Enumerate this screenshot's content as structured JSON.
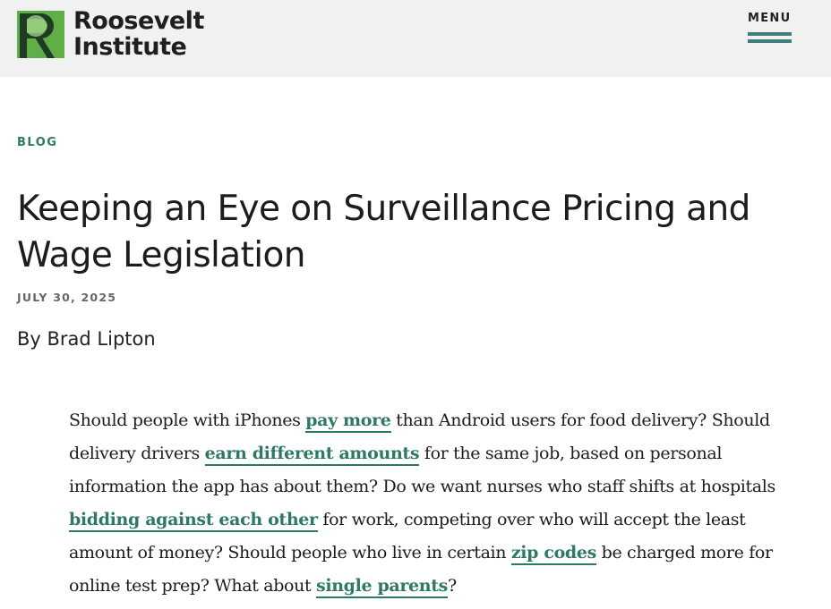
{
  "header": {
    "logo": {
      "line1": "Roosevelt",
      "line2": "Institute",
      "icon": "roosevelt-r-logo"
    },
    "menu_label": "MENU",
    "menu_icon": "hamburger-icon"
  },
  "article": {
    "category": "BLOG",
    "title": "Keeping an Eye on Surveillance Pricing and Wage Legislation",
    "date": "JULY 30, 2025",
    "byline_prefix": "By ",
    "author": "Brad Lipton",
    "paragraph": [
      {
        "type": "text",
        "text": "Should people with iPhones "
      },
      {
        "type": "link",
        "text": "pay more"
      },
      {
        "type": "text",
        "text": " than Android users for food delivery? Should delivery drivers "
      },
      {
        "type": "link",
        "text": "earn different amounts"
      },
      {
        "type": "text",
        "text": " for the same job, based on personal information the app has about them? Do we want nurses who staff shifts at hospitals "
      },
      {
        "type": "link",
        "text": "bidding against each other"
      },
      {
        "type": "text",
        "text": " for work, competing over who will accept the least amount of money? Should people who live in certain "
      },
      {
        "type": "link",
        "text": "zip codes"
      },
      {
        "type": "text",
        "text": " be charged more for online test prep? What about "
      },
      {
        "type": "link",
        "text": "single parents"
      },
      {
        "type": "text",
        "text": "?"
      }
    ]
  },
  "colors": {
    "accent": "#2e7868",
    "menu_bar": "#3f7d79",
    "header_bg": "#f1f1f1",
    "logo_green_dark": "#2f8a3a",
    "logo_green_light": "#6db84f"
  }
}
